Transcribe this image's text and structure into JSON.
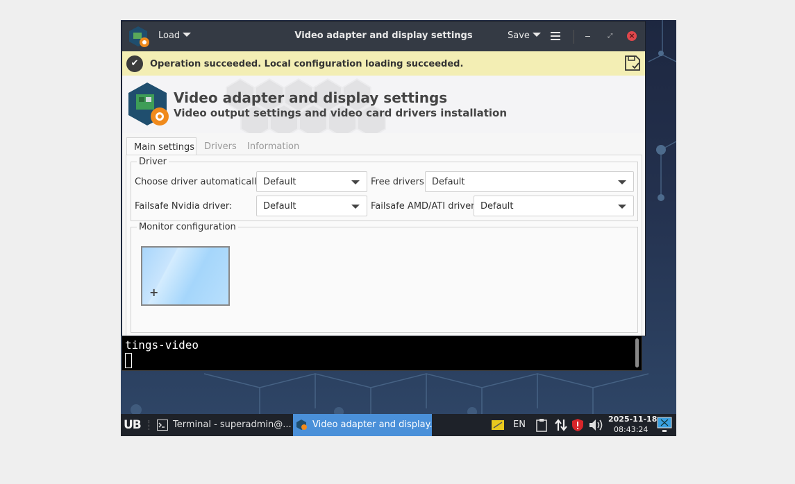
{
  "window": {
    "title": "Video adapter and display settings",
    "load_label": "Load",
    "save_label": "Save"
  },
  "notice": {
    "text": "Operation succeeded. Local configuration loading succeeded."
  },
  "banner": {
    "title": "Video adapter and display settings",
    "subtitle": "Video output settings and video card drivers installation"
  },
  "tabs": [
    {
      "label": "Main settings",
      "active": true
    },
    {
      "label": "Drivers",
      "active": false
    },
    {
      "label": "Information",
      "active": false
    }
  ],
  "driver": {
    "legend": "Driver",
    "auto_label": "Choose driver automatically:",
    "auto_value": "Default",
    "free_label": "Free drivers:",
    "free_value": "Default",
    "nvidia_label": "Failsafe Nvidia driver:",
    "nvidia_value": "Default",
    "amd_label": "Failsafe AMD/ATI driver:",
    "amd_value": "Default"
  },
  "monitor": {
    "legend": "Monitor configuration",
    "add_symbol": "+"
  },
  "terminal": {
    "text": "tings-video"
  },
  "taskbar": {
    "start_label": "UB",
    "tasks": [
      {
        "label": "Terminal - superadmin@...",
        "active": false
      },
      {
        "label": "Video adapter and display...",
        "active": true
      }
    ],
    "lang": "EN",
    "date": "2025-11-18",
    "time": "08:43:24"
  },
  "colors": {
    "accent": "#4a90d9",
    "titlebar": "#343a44",
    "notice_bg": "#f3eeb4",
    "close": "#e0474c",
    "tray_shield": "#d9262a"
  },
  "icons": [
    "app-icon",
    "menu-icon",
    "minimize-icon",
    "restore-icon",
    "close-icon",
    "success-check-icon",
    "saved-config-icon",
    "terminal-icon",
    "settings-app-icon",
    "notes-icon",
    "clipboard-icon",
    "network-icon",
    "shield-icon",
    "volume-icon",
    "screen-icon"
  ]
}
